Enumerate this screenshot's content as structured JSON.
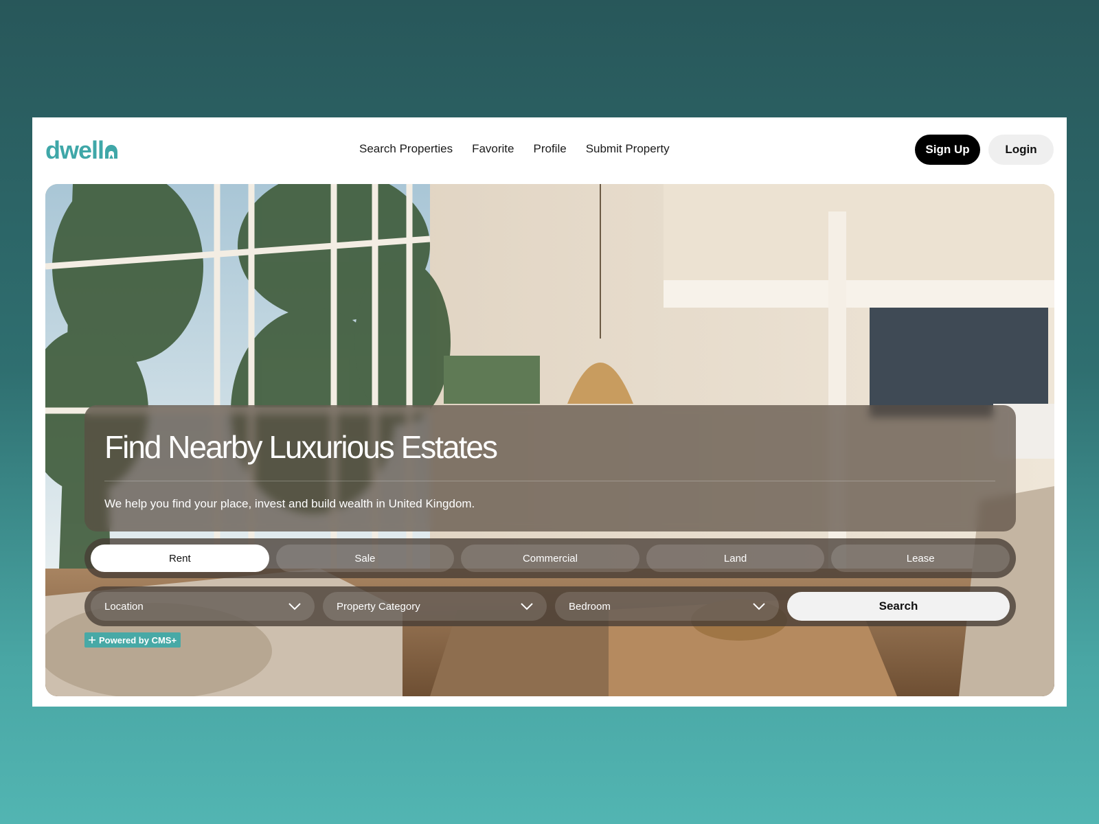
{
  "brand": {
    "logo_text": "dwell",
    "accent_color": "#3fa7a8"
  },
  "nav": {
    "links": [
      "Search Properties",
      "Favorite",
      "Profile",
      "Submit Property"
    ],
    "signup_label": "Sign Up",
    "login_label": "Login"
  },
  "hero": {
    "headline": "Find Nearby Luxurious Estates",
    "subtitle": "We help you find your place, invest and build wealth in United Kingdom."
  },
  "tabs": {
    "items": [
      "Rent",
      "Sale",
      "Commercial",
      "Land",
      "Lease"
    ],
    "selected": "Rent"
  },
  "filters": {
    "location": "Location",
    "category": "Property Category",
    "bedroom": "Bedroom",
    "search_label": "Search",
    "dropdown_icon": "chevron-down-icon"
  },
  "badge": {
    "text": "Powered by CMS+",
    "icon": "plus-icon",
    "color": "#47a9a6"
  }
}
